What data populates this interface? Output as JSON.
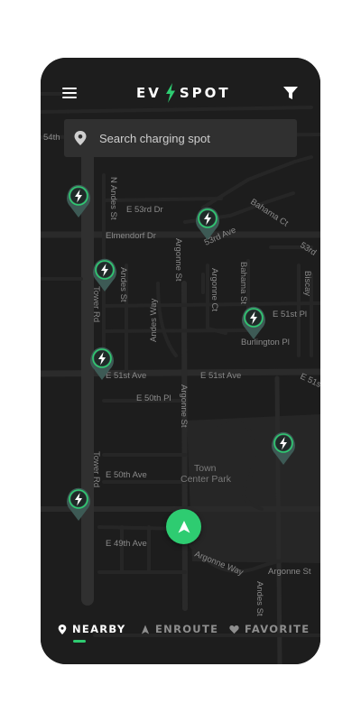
{
  "app": {
    "brand_left": "EV",
    "brand_right": "SPOT",
    "accent_color": "#2ecc71",
    "background_color": "#1c1c1c"
  },
  "header": {
    "menu_icon": "hamburger-menu-icon",
    "filter_icon": "filter-funnel-icon"
  },
  "search": {
    "placeholder": "Search charging spot",
    "icon": "location-pin-icon"
  },
  "map": {
    "labels": [
      "54th",
      "N Andes St",
      "E 53rd Dr",
      "Elmendorf Dr",
      "Bahama Ct",
      "53rd Ave",
      "53rd",
      "Tower Rd",
      "Andes St",
      "Andes Way",
      "Argonne St",
      "Argonne Ct",
      "Bahama St",
      "E 51st Pl",
      "Biscay",
      "Burlington Pl",
      "E 51st Ave",
      "E 51st Ave",
      "E 51s",
      "E 50th Pl",
      "Argonne St",
      "Town",
      "Center Park",
      "Tower Rd",
      "E 50th Ave",
      "E 49th Ave",
      "Argonne Way",
      "Argonne St",
      "Andes St"
    ],
    "charging_markers": 7,
    "marker_icon": "charging-bolt-icon",
    "recenter_icon": "navigation-arrow-icon"
  },
  "tabs": [
    {
      "label": "NEARBY",
      "icon": "location-pin-icon",
      "active": true
    },
    {
      "label": "ENROUTE",
      "icon": "route-arrow-icon",
      "active": false
    },
    {
      "label": "FAVORITE",
      "icon": "heart-icon",
      "active": false
    }
  ]
}
